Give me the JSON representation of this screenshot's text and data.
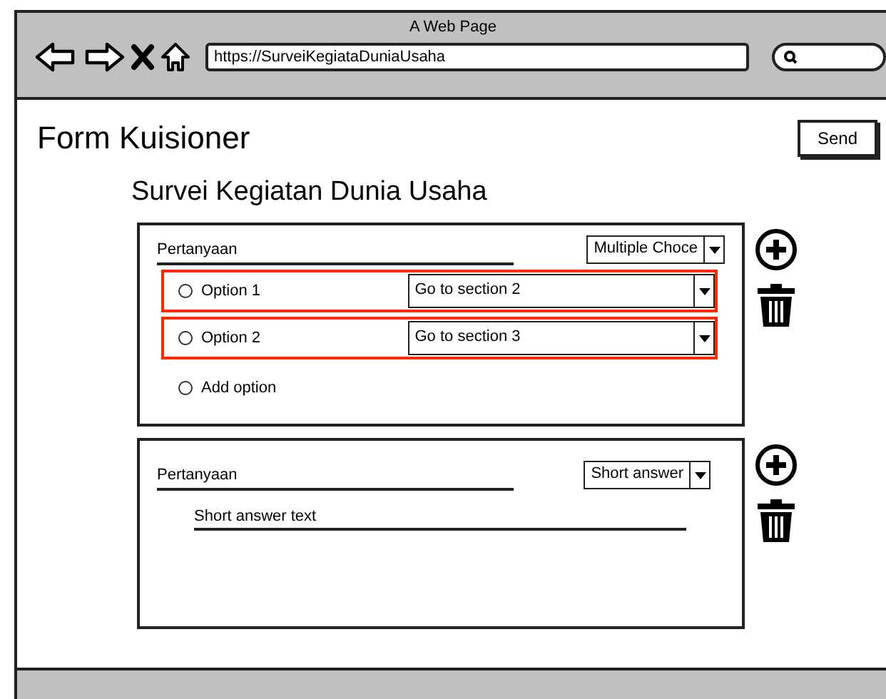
{
  "browser": {
    "title": "A Web Page",
    "url": "https://SurveiKegiataDuniaUsaha"
  },
  "page": {
    "title": "Form Kuisioner",
    "send_button": "Send",
    "subtitle": "Survei Kegiatan Dunia Usaha"
  },
  "questions": [
    {
      "kind": "multiple_choice",
      "question": "Pertanyaan",
      "type": "Multiple Choce",
      "options": [
        {
          "label": "Option 1",
          "target": "Go to section 2",
          "highlighted": true,
          "selected": false
        },
        {
          "label": "Option 2",
          "target": "Go to section 3",
          "highlighted": true,
          "selected": false
        }
      ],
      "add_option": {
        "label": "Add option",
        "selected": false
      }
    },
    {
      "kind": "short_answer",
      "question": "Pertanyaan",
      "type": "Short answer",
      "placeholder": "Short answer text"
    }
  ]
}
